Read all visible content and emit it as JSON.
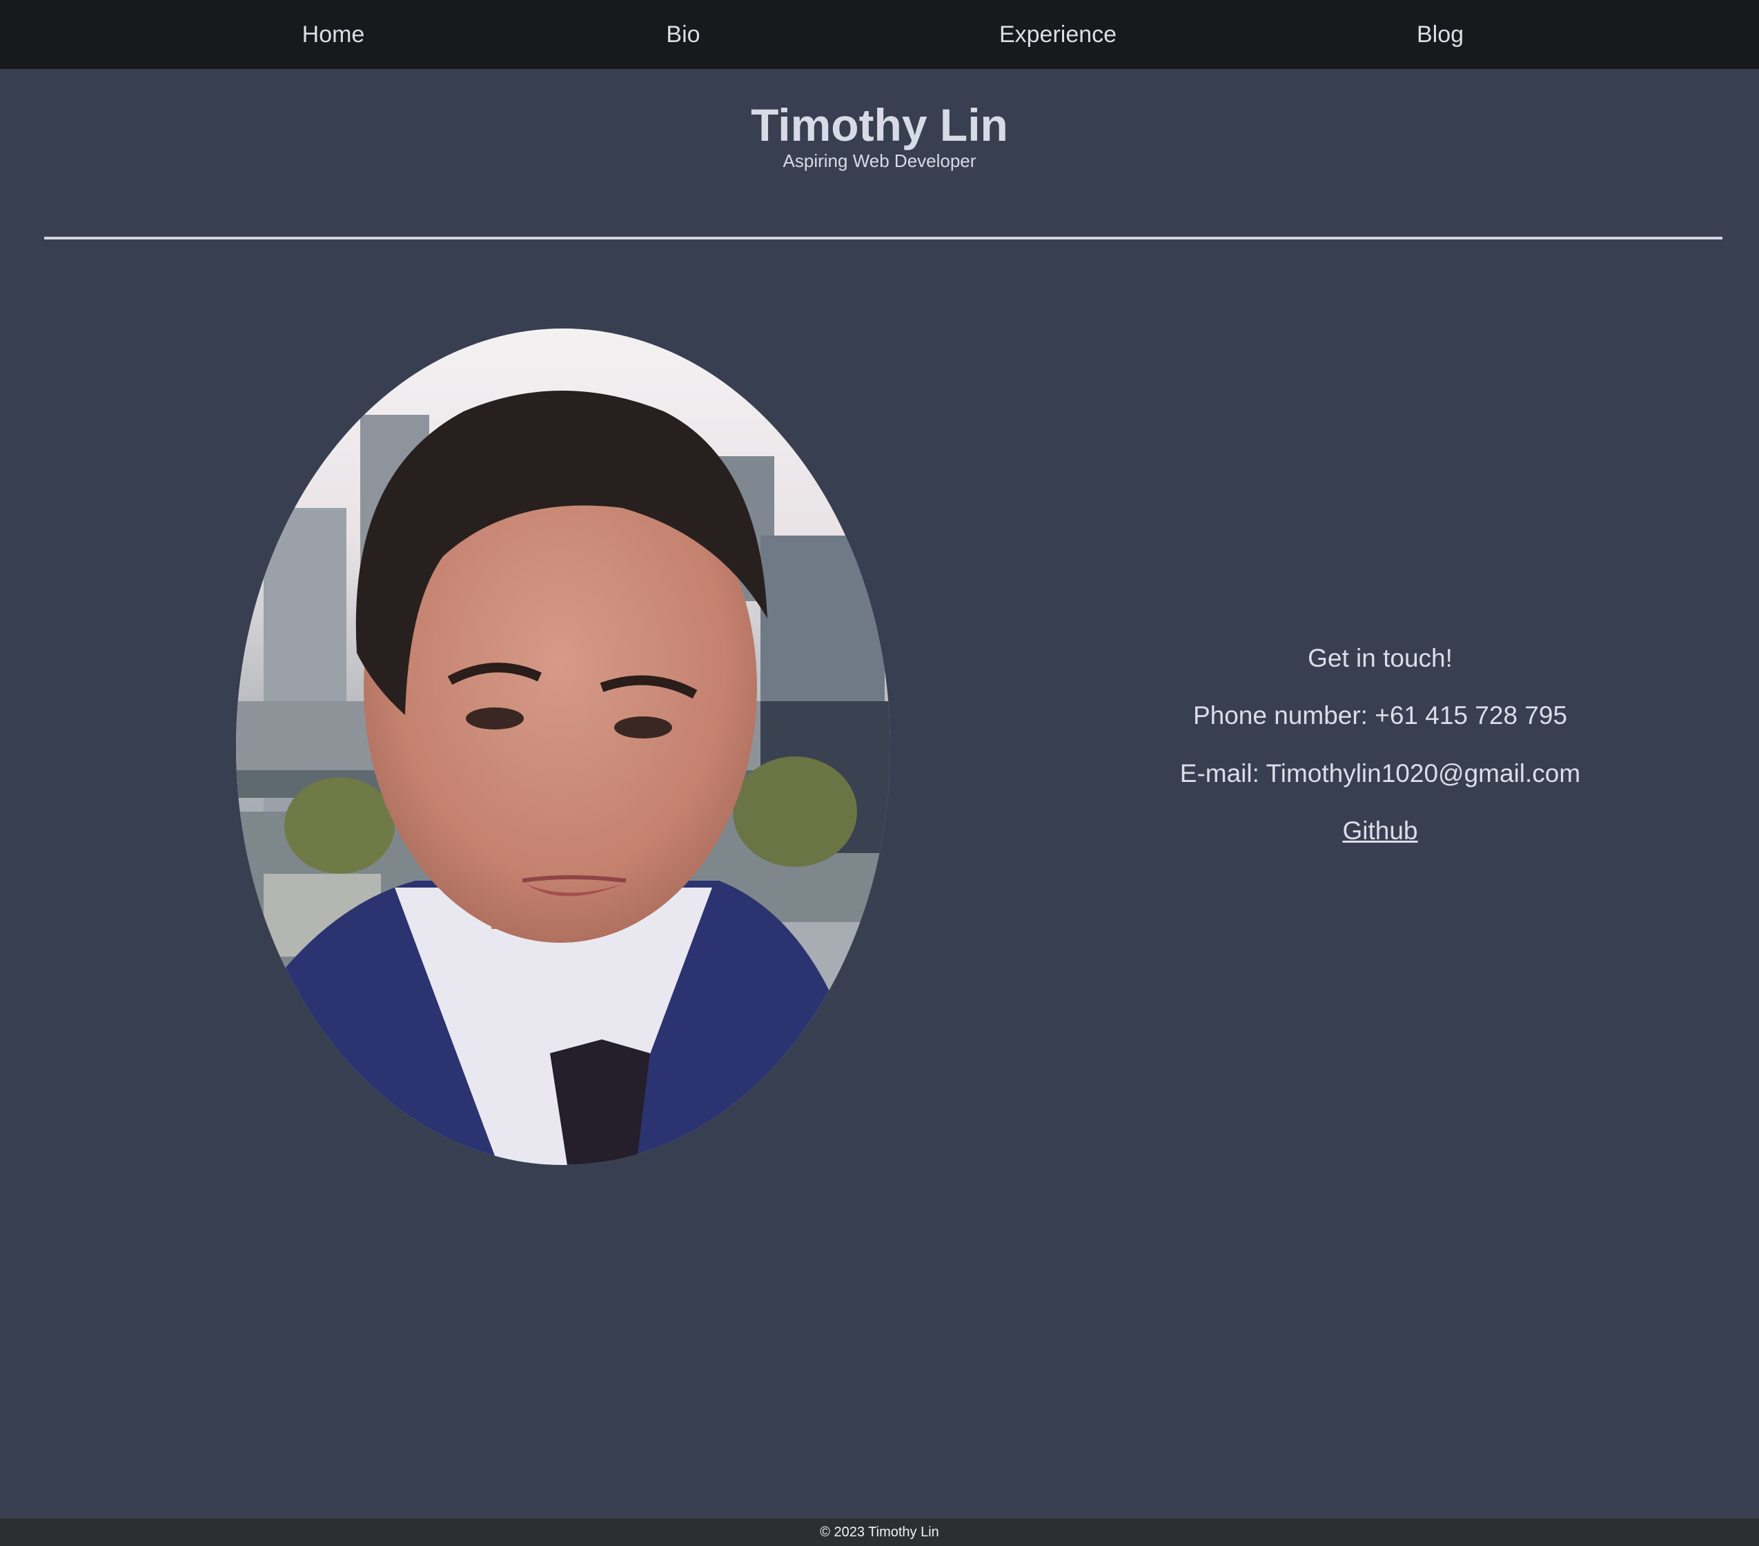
{
  "nav": {
    "items": [
      {
        "label": "Home"
      },
      {
        "label": "Bio"
      },
      {
        "label": "Experience"
      },
      {
        "label": "Blog"
      }
    ]
  },
  "header": {
    "title": "Timothy Lin",
    "subtitle": "Aspiring Web Developer"
  },
  "contact": {
    "heading": "Get in touch!",
    "phone": "Phone number: +61 415 728 795",
    "email": "E-mail: Timothylin1020@gmail.com",
    "github_label": "Github"
  },
  "footer": {
    "copyright": "© 2023 Timothy Lin"
  },
  "colors": {
    "page_background": "#383f51",
    "nav_background": "#18191c",
    "footer_background": "#2d2e2f",
    "text": "#dadee8"
  }
}
